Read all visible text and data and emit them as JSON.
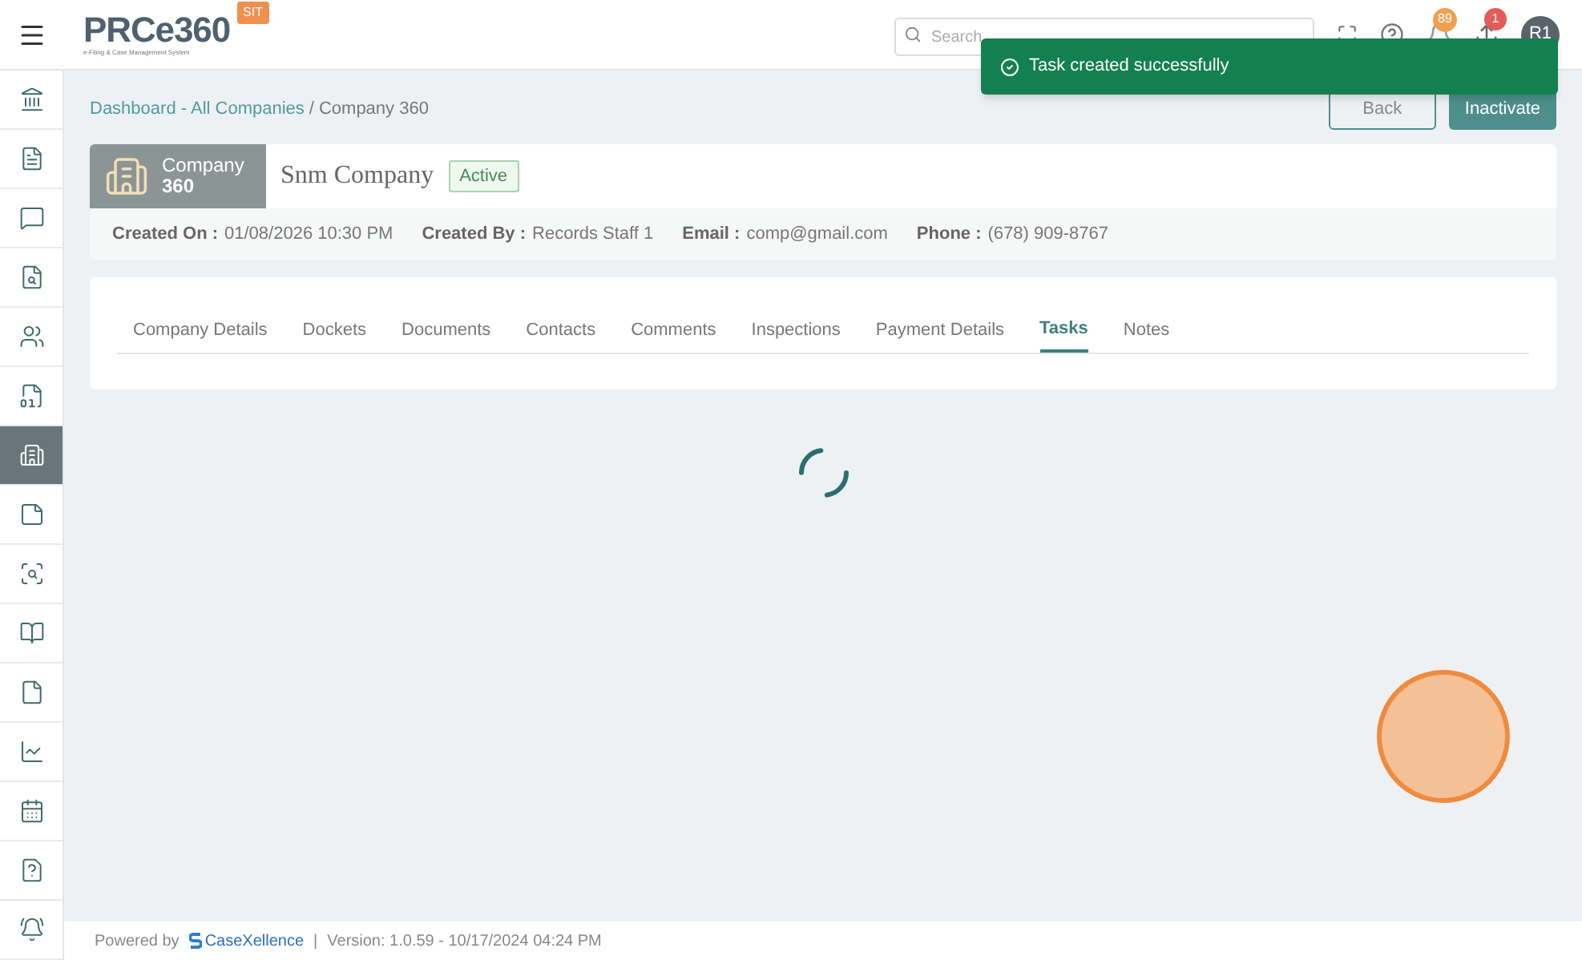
{
  "header": {
    "logo": {
      "text": "PRCe360",
      "tagline": "e-Filing & Case Management System",
      "env_badge": "SIT"
    },
    "search": {
      "placeholder": "Search"
    },
    "notifications_count": "89",
    "alerts_count": "1",
    "avatar": "R1"
  },
  "toast": {
    "message": "Task created successfully"
  },
  "sidebar": {
    "items": [
      {
        "selected": false
      },
      {
        "selected": false
      },
      {
        "selected": false
      },
      {
        "selected": false
      },
      {
        "selected": false
      },
      {
        "selected": false
      },
      {
        "selected": true
      },
      {
        "selected": false
      },
      {
        "selected": false
      },
      {
        "selected": false
      },
      {
        "selected": false
      },
      {
        "selected": false
      },
      {
        "selected": false
      },
      {
        "selected": false
      },
      {
        "selected": false
      }
    ]
  },
  "breadcrumb": {
    "link": "Dashboard - All Companies",
    "separator": "/",
    "current": "Company 360"
  },
  "buttons": [
    {
      "label": "Back",
      "kind": "outline"
    },
    {
      "label": "Inactivate",
      "kind": "primary"
    }
  ],
  "company": {
    "tag_line1": "Company",
    "tag_line2": "360",
    "name": "Snm Company",
    "status": "Active",
    "info": [
      {
        "label": "Created On :",
        "value": "01/08/2026 10:30 PM"
      },
      {
        "label": "Created By :",
        "value": "Records Staff 1"
      },
      {
        "label": "Email :",
        "value": "comp@gmail.com"
      },
      {
        "label": "Phone :",
        "value": "(678) 909-8767"
      }
    ]
  },
  "tabs": [
    {
      "label": "Company Details",
      "selected": false
    },
    {
      "label": "Dockets",
      "selected": false
    },
    {
      "label": "Documents",
      "selected": false
    },
    {
      "label": "Contacts",
      "selected": false
    },
    {
      "label": "Comments",
      "selected": false
    },
    {
      "label": "Inspections",
      "selected": false
    },
    {
      "label": "Payment Details",
      "selected": false
    },
    {
      "label": "Tasks",
      "selected": true
    },
    {
      "label": "Notes",
      "selected": false
    }
  ],
  "footer": {
    "powered_by": "Powered by",
    "brand": "CaseXellence",
    "separator": "|",
    "version": "Version: 1.0.59 - 10/17/2024 04:24 PM"
  }
}
